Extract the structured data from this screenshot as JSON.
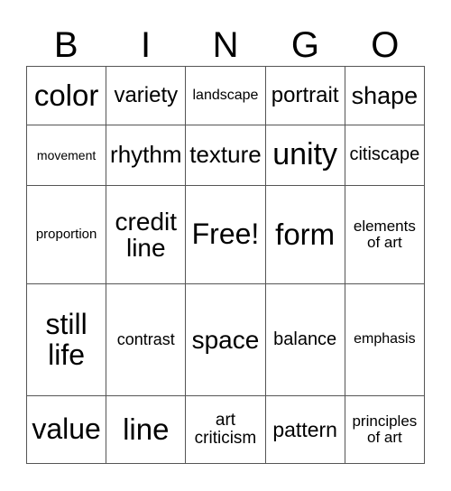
{
  "header": [
    "B",
    "I",
    "N",
    "G",
    "O"
  ],
  "rows": [
    [
      {
        "text": "color",
        "size": 33
      },
      {
        "text": "variety",
        "size": 24
      },
      {
        "text": "landscape",
        "size": 16
      },
      {
        "text": "portrait",
        "size": 24
      },
      {
        "text": "shape",
        "size": 27
      }
    ],
    [
      {
        "text": "movement",
        "size": 14
      },
      {
        "text": "rhythm",
        "size": 26
      },
      {
        "text": "texture",
        "size": 26
      },
      {
        "text": "unity",
        "size": 34
      },
      {
        "text": "citiscape",
        "size": 20
      }
    ],
    [
      {
        "text": "proportion",
        "size": 15
      },
      {
        "text": "credit line",
        "size": 28
      },
      {
        "text": "Free!",
        "size": 32
      },
      {
        "text": "form",
        "size": 33
      },
      {
        "text": "elements of art",
        "size": 17
      }
    ],
    [
      {
        "text": "still life",
        "size": 32
      },
      {
        "text": "contrast",
        "size": 18
      },
      {
        "text": "space",
        "size": 28
      },
      {
        "text": "balance",
        "size": 20
      },
      {
        "text": "emphasis",
        "size": 16
      }
    ],
    [
      {
        "text": "value",
        "size": 32
      },
      {
        "text": "line",
        "size": 33
      },
      {
        "text": "art criticism",
        "size": 19
      },
      {
        "text": "pattern",
        "size": 23
      },
      {
        "text": "principles of art",
        "size": 17
      }
    ]
  ]
}
